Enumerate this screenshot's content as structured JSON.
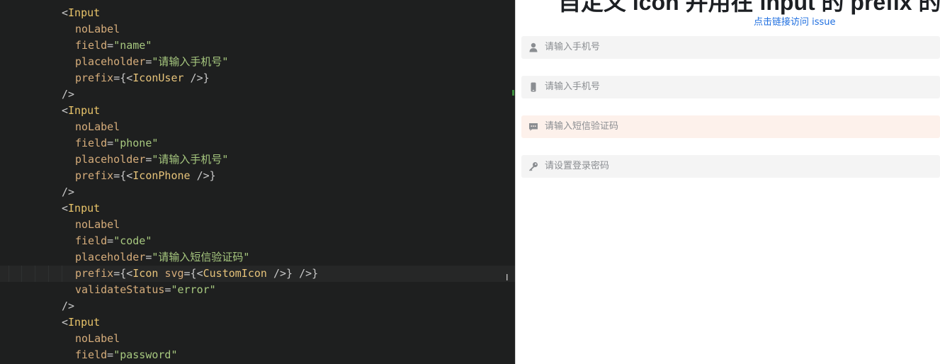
{
  "editor": {
    "lines": [
      {
        "indent": 1,
        "tokens": [
          [
            "punc",
            "<"
          ],
          [
            "tag",
            "Input"
          ]
        ]
      },
      {
        "indent": 2,
        "tokens": [
          [
            "attr",
            "noLabel"
          ]
        ]
      },
      {
        "indent": 2,
        "tokens": [
          [
            "attr",
            "field"
          ],
          [
            "punc",
            "="
          ],
          [
            "str",
            "\"name\""
          ]
        ]
      },
      {
        "indent": 2,
        "tokens": [
          [
            "attr",
            "placeholder"
          ],
          [
            "punc",
            "="
          ],
          [
            "str",
            "\"请输入手机号\""
          ]
        ]
      },
      {
        "indent": 2,
        "tokens": [
          [
            "attr",
            "prefix"
          ],
          [
            "punc",
            "={<"
          ],
          [
            "comp",
            "IconUser"
          ],
          [
            "punc",
            " />}"
          ]
        ]
      },
      {
        "indent": 1,
        "tokens": [
          [
            "punc",
            "/>"
          ]
        ]
      },
      {
        "indent": 1,
        "tokens": [
          [
            "punc",
            "<"
          ],
          [
            "tag",
            "Input"
          ]
        ]
      },
      {
        "indent": 2,
        "tokens": [
          [
            "attr",
            "noLabel"
          ]
        ]
      },
      {
        "indent": 2,
        "tokens": [
          [
            "attr",
            "field"
          ],
          [
            "punc",
            "="
          ],
          [
            "str",
            "\"phone\""
          ]
        ]
      },
      {
        "indent": 2,
        "tokens": [
          [
            "attr",
            "placeholder"
          ],
          [
            "punc",
            "="
          ],
          [
            "str",
            "\"请输入手机号\""
          ]
        ]
      },
      {
        "indent": 2,
        "tokens": [
          [
            "attr",
            "prefix"
          ],
          [
            "punc",
            "={<"
          ],
          [
            "comp",
            "IconPhone"
          ],
          [
            "punc",
            " />}"
          ]
        ]
      },
      {
        "indent": 1,
        "tokens": [
          [
            "punc",
            "/>"
          ]
        ]
      },
      {
        "indent": 1,
        "tokens": [
          [
            "punc",
            "<"
          ],
          [
            "tag",
            "Input"
          ]
        ]
      },
      {
        "indent": 2,
        "tokens": [
          [
            "attr",
            "noLabel"
          ]
        ]
      },
      {
        "indent": 2,
        "tokens": [
          [
            "attr",
            "field"
          ],
          [
            "punc",
            "="
          ],
          [
            "str",
            "\"code\""
          ]
        ]
      },
      {
        "indent": 2,
        "tokens": [
          [
            "attr",
            "placeholder"
          ],
          [
            "punc",
            "="
          ],
          [
            "str",
            "\"请输入短信验证码\""
          ]
        ]
      },
      {
        "indent": 2,
        "active": true,
        "tokens": [
          [
            "attr",
            "prefix"
          ],
          [
            "punc",
            "={<"
          ],
          [
            "comp",
            "Icon"
          ],
          [
            "punc",
            " "
          ],
          [
            "attr",
            "svg"
          ],
          [
            "punc",
            "={<"
          ],
          [
            "comp",
            "CustomIcon"
          ],
          [
            "punc",
            " />} />}"
          ]
        ]
      },
      {
        "indent": 2,
        "tokens": [
          [
            "attr",
            "validateStatus"
          ],
          [
            "punc",
            "="
          ],
          [
            "str",
            "\"error\""
          ]
        ]
      },
      {
        "indent": 1,
        "tokens": [
          [
            "punc",
            "/>"
          ]
        ]
      },
      {
        "indent": 1,
        "tokens": [
          [
            "punc",
            "<"
          ],
          [
            "tag",
            "Input"
          ]
        ]
      },
      {
        "indent": 2,
        "tokens": [
          [
            "attr",
            "noLabel"
          ]
        ]
      },
      {
        "indent": 2,
        "tokens": [
          [
            "attr",
            "field"
          ],
          [
            "punc",
            "="
          ],
          [
            "str",
            "\"password\""
          ]
        ]
      }
    ]
  },
  "preview": {
    "title": "自定义 icon 并用在 input 的 prefix 的情况",
    "link": "点击链接访问 issue",
    "fields": [
      {
        "icon": "user-icon",
        "placeholder": "请输入手机号",
        "status": "default"
      },
      {
        "icon": "phone-icon",
        "placeholder": "请输入手机号",
        "status": "default"
      },
      {
        "icon": "message-icon",
        "placeholder": "请输入短信验证码",
        "status": "error"
      },
      {
        "icon": "key-icon",
        "placeholder": "请设置登录密码",
        "status": "default"
      }
    ]
  },
  "colors": {
    "editor_bg": "#1e1f1f",
    "link": "#1f6fe0",
    "error_field_bg": "#fdf1eb",
    "field_bg": "#f4f4f4"
  }
}
